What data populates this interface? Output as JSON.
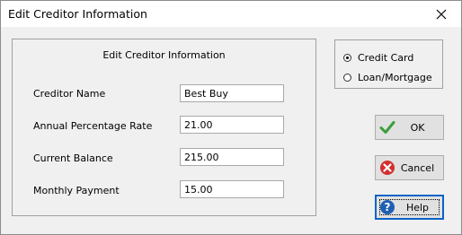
{
  "window": {
    "title": "Edit Creditor Information"
  },
  "form": {
    "heading": "Edit Creditor Information",
    "fields": [
      {
        "label": "Creditor Name",
        "value": "Best Buy"
      },
      {
        "label": "Annual Percentage Rate",
        "value": "21.00"
      },
      {
        "label": "Current Balance",
        "value": "215.00"
      },
      {
        "label": "Monthly Payment",
        "value": "15.00"
      }
    ]
  },
  "account_type": {
    "options": [
      {
        "label": "Credit Card",
        "selected": true
      },
      {
        "label": "Loan/Mortgage",
        "selected": false
      }
    ]
  },
  "buttons": {
    "ok": "OK",
    "cancel": "Cancel",
    "help": "Help"
  },
  "icons": {
    "close": "close-icon",
    "ok": "check-icon",
    "cancel": "cancel-icon",
    "help": "help-icon"
  },
  "colors": {
    "check_green": "#3a9e3a",
    "cancel_red": "#d32f2f",
    "help_blue": "#1e5fb4",
    "focus_border": "#0a64c8"
  }
}
